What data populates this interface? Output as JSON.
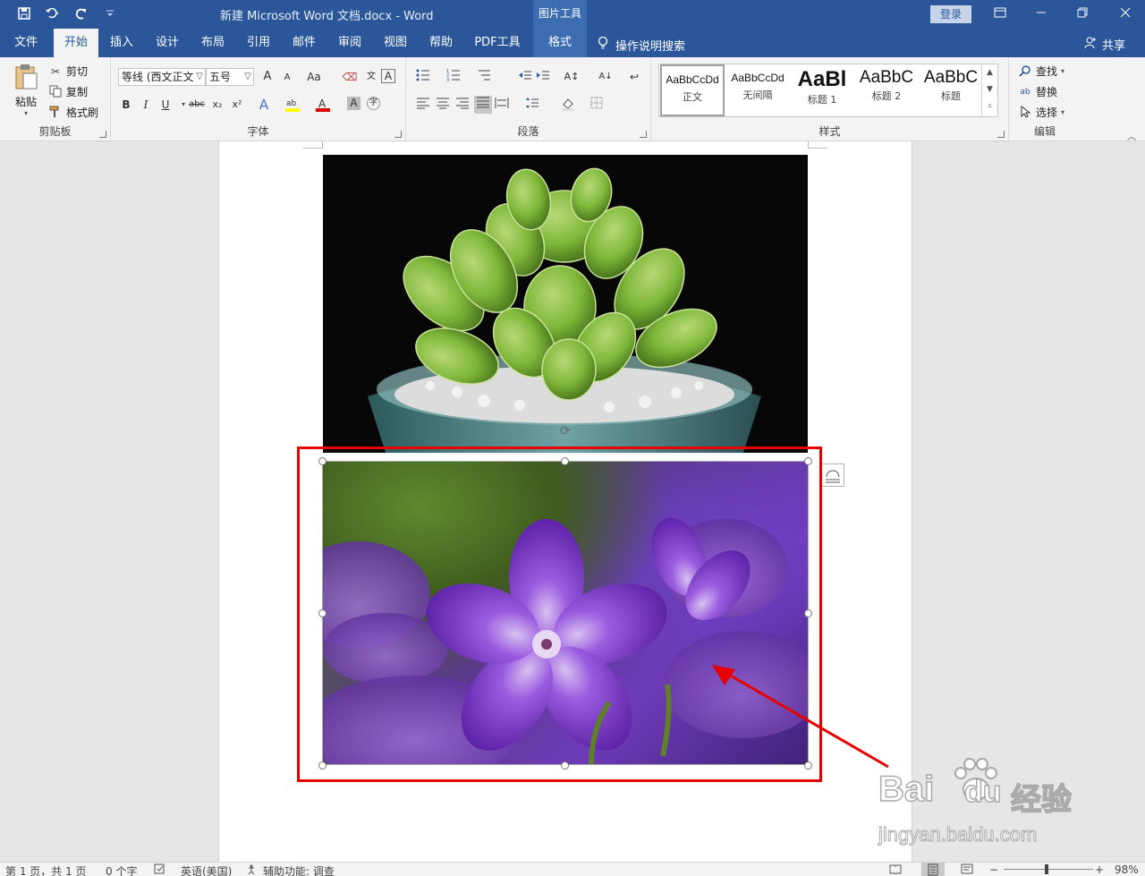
{
  "title_bar": {
    "doc_title": "新建 Microsoft Word 文档.docx  -  Word",
    "context_tool_group": "图片工具",
    "login_label": "登录",
    "qat": [
      "save-icon",
      "undo-icon",
      "redo-icon",
      "customize-icon"
    ]
  },
  "tabs": [
    {
      "label": "文件"
    },
    {
      "label": "开始",
      "active": true
    },
    {
      "label": "插入"
    },
    {
      "label": "设计"
    },
    {
      "label": "布局"
    },
    {
      "label": "引用"
    },
    {
      "label": "邮件"
    },
    {
      "label": "审阅"
    },
    {
      "label": "视图"
    },
    {
      "label": "帮助"
    },
    {
      "label": "PDF工具"
    },
    {
      "label": "格式",
      "context": true
    }
  ],
  "tell_me": "操作说明搜索",
  "share_label": "共享",
  "ribbon": {
    "clipboard": {
      "label": "剪贴板",
      "paste": "粘贴",
      "cut": "剪切",
      "copy": "复制",
      "format_painter": "格式刷"
    },
    "font": {
      "label": "字体",
      "font_name": "等线 (西文正文",
      "font_size": "五号",
      "grow": "A",
      "shrink": "A",
      "change_case": "Aa",
      "bold": "B",
      "italic": "I",
      "underline": "U",
      "strike": "abc",
      "subscript": "x₂",
      "superscript": "x²"
    },
    "paragraph": {
      "label": "段落"
    },
    "styles": {
      "label": "样式",
      "items": [
        {
          "sample": "AaBbCcDd",
          "name": "正文"
        },
        {
          "sample": "AaBbCcDd",
          "name": "无间隔"
        },
        {
          "sample": "AaBl",
          "name": "标题 1"
        },
        {
          "sample": "AaBbC",
          "name": "标题 2"
        },
        {
          "sample": "AaBbC",
          "name": "标题"
        }
      ]
    },
    "editing": {
      "label": "编辑",
      "find": "查找",
      "replace": "替换",
      "select": "选择"
    }
  },
  "document": {
    "images": [
      {
        "name": "succulent-image",
        "description_color": "#0a0a0a"
      },
      {
        "name": "purple-flower-image",
        "selected": true
      }
    ],
    "annotation_color": "#e60000"
  },
  "watermark": {
    "brand": "Bai",
    "brand2": "du",
    "suffix": "经验",
    "url": "jingyan.baidu.com"
  },
  "status_bar": {
    "page": "第 1 页，共 1 页",
    "words": "0 个字",
    "language": "英语(美国)",
    "accessibility": "辅助功能: 调查",
    "zoom": "98%"
  },
  "colors": {
    "brand": "#2b579a",
    "ribbon_bg": "#f3f3f3",
    "canvas_bg": "#e6e6e6"
  }
}
